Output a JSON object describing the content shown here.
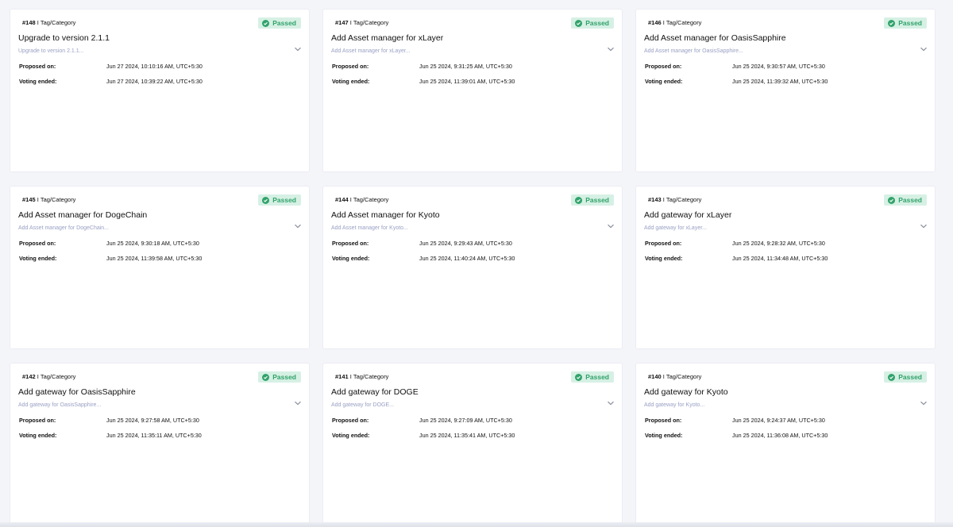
{
  "colors": {
    "page_bg": "#f4f5f9",
    "card_bg": "#ffffff",
    "badge_bg": "#d6f0e4",
    "badge_text": "#31a36b",
    "subtitle": "#9aa1c4"
  },
  "labels": {
    "proposed": "Proposed on:",
    "voting": "Voting ended:",
    "separator": "I",
    "category": "Tag/Category"
  },
  "proposals": [
    {
      "number": "#148",
      "status": "Passed",
      "title": "Upgrade to version 2.1.1",
      "subtitle": "Upgrade to version 2.1.1...",
      "proposed_on": "Jun 27 2024, 10:10:16 AM, UTC+5:30",
      "voting_ended": "Jun 27 2024, 10:39:22 AM, UTC+5:30"
    },
    {
      "number": "#147",
      "status": "Passed",
      "title": "Add Asset manager for xLayer",
      "subtitle": "Add Asset manager for xLayer...",
      "proposed_on": "Jun 25 2024, 9:31:25 AM, UTC+5:30",
      "voting_ended": "Jun 25 2024, 11:39:01 AM, UTC+5:30"
    },
    {
      "number": "#146",
      "status": "Passed",
      "title": "Add Asset manager for OasisSapphire",
      "subtitle": "Add Asset manager for OasisSapphire...",
      "proposed_on": "Jun 25 2024, 9:30:57 AM, UTC+5:30",
      "voting_ended": "Jun 25 2024, 11:39:32 AM, UTC+5:30"
    },
    {
      "number": "#145",
      "status": "Passed",
      "title": "Add Asset manager for DogeChain",
      "subtitle": "Add Asset manager for DogeChain...",
      "proposed_on": "Jun 25 2024, 9:30:18 AM, UTC+5:30",
      "voting_ended": "Jun 25 2024, 11:39:58 AM, UTC+5:30"
    },
    {
      "number": "#144",
      "status": "Passed",
      "title": "Add Asset manager for Kyoto",
      "subtitle": "Add Asset manager for Kyoto...",
      "proposed_on": "Jun 25 2024, 9:29:43 AM, UTC+5:30",
      "voting_ended": "Jun 25 2024, 11:40:24 AM, UTC+5:30"
    },
    {
      "number": "#143",
      "status": "Passed",
      "title": "Add gateway for xLayer",
      "subtitle": "Add gateway for xLayer...",
      "proposed_on": "Jun 25 2024, 9:28:32 AM, UTC+5:30",
      "voting_ended": "Jun 25 2024, 11:34:48 AM, UTC+5:30"
    },
    {
      "number": "#142",
      "status": "Passed",
      "title": "Add gateway for OasisSapphire",
      "subtitle": "Add gateway for OasisSapphire...",
      "proposed_on": "Jun 25 2024, 9:27:58 AM, UTC+5:30",
      "voting_ended": "Jun 25 2024, 11:35:11 AM, UTC+5:30"
    },
    {
      "number": "#141",
      "status": "Passed",
      "title": "Add gateway for DOGE",
      "subtitle": "Add gateway for DOGE...",
      "proposed_on": "Jun 25 2024, 9:27:09 AM, UTC+5:30",
      "voting_ended": "Jun 25 2024, 11:35:41 AM, UTC+5:30"
    },
    {
      "number": "#140",
      "status": "Passed",
      "title": "Add gateway for Kyoto",
      "subtitle": "Add gateway for Kyoto...",
      "proposed_on": "Jun 25 2024, 9:24:37 AM, UTC+5:30",
      "voting_ended": "Jun 25 2024, 11:36:08 AM, UTC+5:30"
    }
  ]
}
